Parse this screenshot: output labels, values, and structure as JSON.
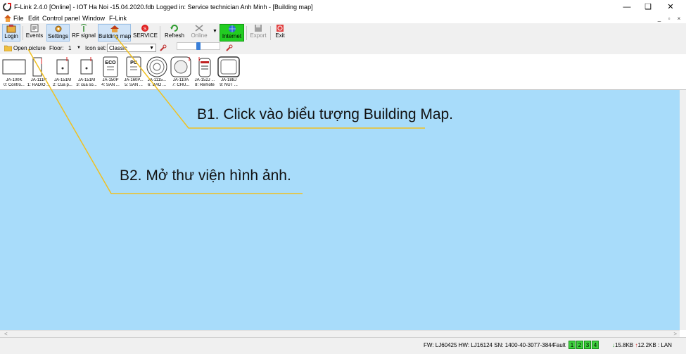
{
  "window": {
    "title": "F-Link 2.4.0 [Online] - IOT Ha Noi -15.04.2020.fdb Logged in: Service technician Anh Minh - [Building map]",
    "controls": [
      "—",
      "❑",
      "✕"
    ]
  },
  "menu": {
    "items": [
      "File",
      "Edit",
      "Control panel",
      "Window",
      "F-Link"
    ],
    "mdi_controls": [
      "_",
      "▫",
      "×"
    ]
  },
  "toolbar": {
    "login": "Login",
    "events": "Events",
    "settings": "Settings",
    "rf_signal": "RF signal",
    "building_map": "Building map",
    "service": "SERVICE",
    "refresh": "Refresh",
    "online": "Online",
    "internet": "Internet",
    "export": "Export",
    "exit": "Exit"
  },
  "toolbar2": {
    "open_picture": "Open picture",
    "floor_label": "Floor:",
    "floor_value": "1",
    "iconset_label": "Icon set:",
    "iconset_value": "Classic",
    "zoom_level": 0.5
  },
  "devices": [
    {
      "code": "JA-100K",
      "name": "0: Contro..."
    },
    {
      "code": "JA-111R",
      "name": "1: RADIO ..."
    },
    {
      "code": "JA-151M",
      "name": "2: Cua p..."
    },
    {
      "code": "JA-151M",
      "name": "3: cua so..."
    },
    {
      "code": "JA-150P",
      "name": "4: SÁN ..."
    },
    {
      "code": "JA-160P...",
      "name": "5: SÁN ..."
    },
    {
      "code": "JA-1115...",
      "name": "6: BÁO ..."
    },
    {
      "code": "JA-110A",
      "name": "7: CHU..."
    },
    {
      "code": "JA-152J ...",
      "name": "8: Remote"
    },
    {
      "code": "JA-188J",
      "name": "9: NÚT ..."
    }
  ],
  "device_glyph_text": {
    "eco": "ECO",
    "pc": "PC"
  },
  "annotations": {
    "step1": "B1. Click vào biểu tượng Building Map.",
    "step2": "B2. Mở thư viện hình ảnh."
  },
  "statusbar": {
    "fw": "FW: LJ60425 HW: LJ16124 SN: 1400-40-3077-3844",
    "fault": "Fault",
    "zones": [
      "1",
      "2",
      "3",
      "4"
    ],
    "download": "15.8KB",
    "upload": "12.2KB : LAN"
  },
  "colors": {
    "canvas": "#a8dcfa",
    "annotation_line": "#f0c020",
    "internet_button": "#22cc22",
    "zone_ok": "#3ed13e"
  }
}
